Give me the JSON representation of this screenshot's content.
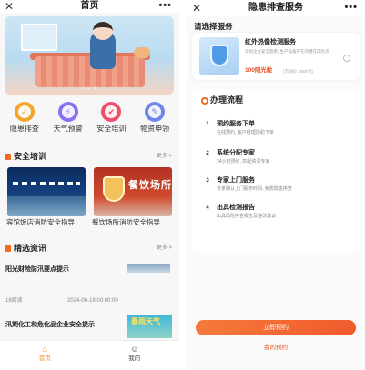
{
  "home": {
    "title": "首页",
    "close_glyph": "✕",
    "more_glyph": "•••",
    "banner_dots": "• • •",
    "menu": [
      {
        "label": "隐患排查",
        "color": "#f3a52b",
        "glyph": "✓"
      },
      {
        "label": "天气预警",
        "color": "#8a6ff0",
        "glyph": "⚡"
      },
      {
        "label": "安全培训",
        "color": "#ef4e6a",
        "glyph": "✔"
      },
      {
        "label": "物资申领",
        "color": "#6f86e8",
        "glyph": "✎"
      }
    ],
    "training": {
      "title": "安全培训",
      "more": "更多 >",
      "cards": [
        {
          "caption": "宾馆饭店消防安全指导"
        },
        {
          "caption": "餐饮场所消防安全指导",
          "overlay": "餐饮场所"
        }
      ]
    },
    "news": {
      "title": "精选资讯",
      "more": "更多 >",
      "items": [
        {
          "title": "阳光财险防汛要点提示",
          "views": "18阅读",
          "date": "2024-06-18 00:00:00"
        },
        {
          "title": "汛期化工和危化品企业安全提示",
          "image_text": "暴雨天气"
        }
      ]
    },
    "tabbar": [
      {
        "label": "首页",
        "icon": "home-icon",
        "glyph": "⌂",
        "active": true
      },
      {
        "label": "我的",
        "icon": "user-icon",
        "glyph": "☺",
        "active": false
      }
    ]
  },
  "service": {
    "title": "隐患排查服务",
    "close_glyph": "✕",
    "more_glyph": "•••",
    "choose_label": "请选择服务",
    "card": {
      "name": "红外热像检测服务",
      "desc": "识别企业安全隐患, 生产设备存在的潜在风险点",
      "price": "100阳光粒",
      "original": "(市场价: 3000元)"
    },
    "flow_title": "办理流程",
    "steps": [
      {
        "num": "1",
        "title": "预约服务下单",
        "desc": "在线预约, 客户经理协助下单"
      },
      {
        "num": "2",
        "title": "系统分配专家",
        "desc": "24小时预约, 匹配资深专家"
      },
      {
        "num": "3",
        "title": "专家上门服务",
        "desc": "专家确认上门服务时间, 免费隐患排查"
      },
      {
        "num": "4",
        "title": "出具检测报告",
        "desc": "出具风险排查报告及整改建议"
      }
    ],
    "cta": "立即预约",
    "my_orders": "我的预约"
  }
}
